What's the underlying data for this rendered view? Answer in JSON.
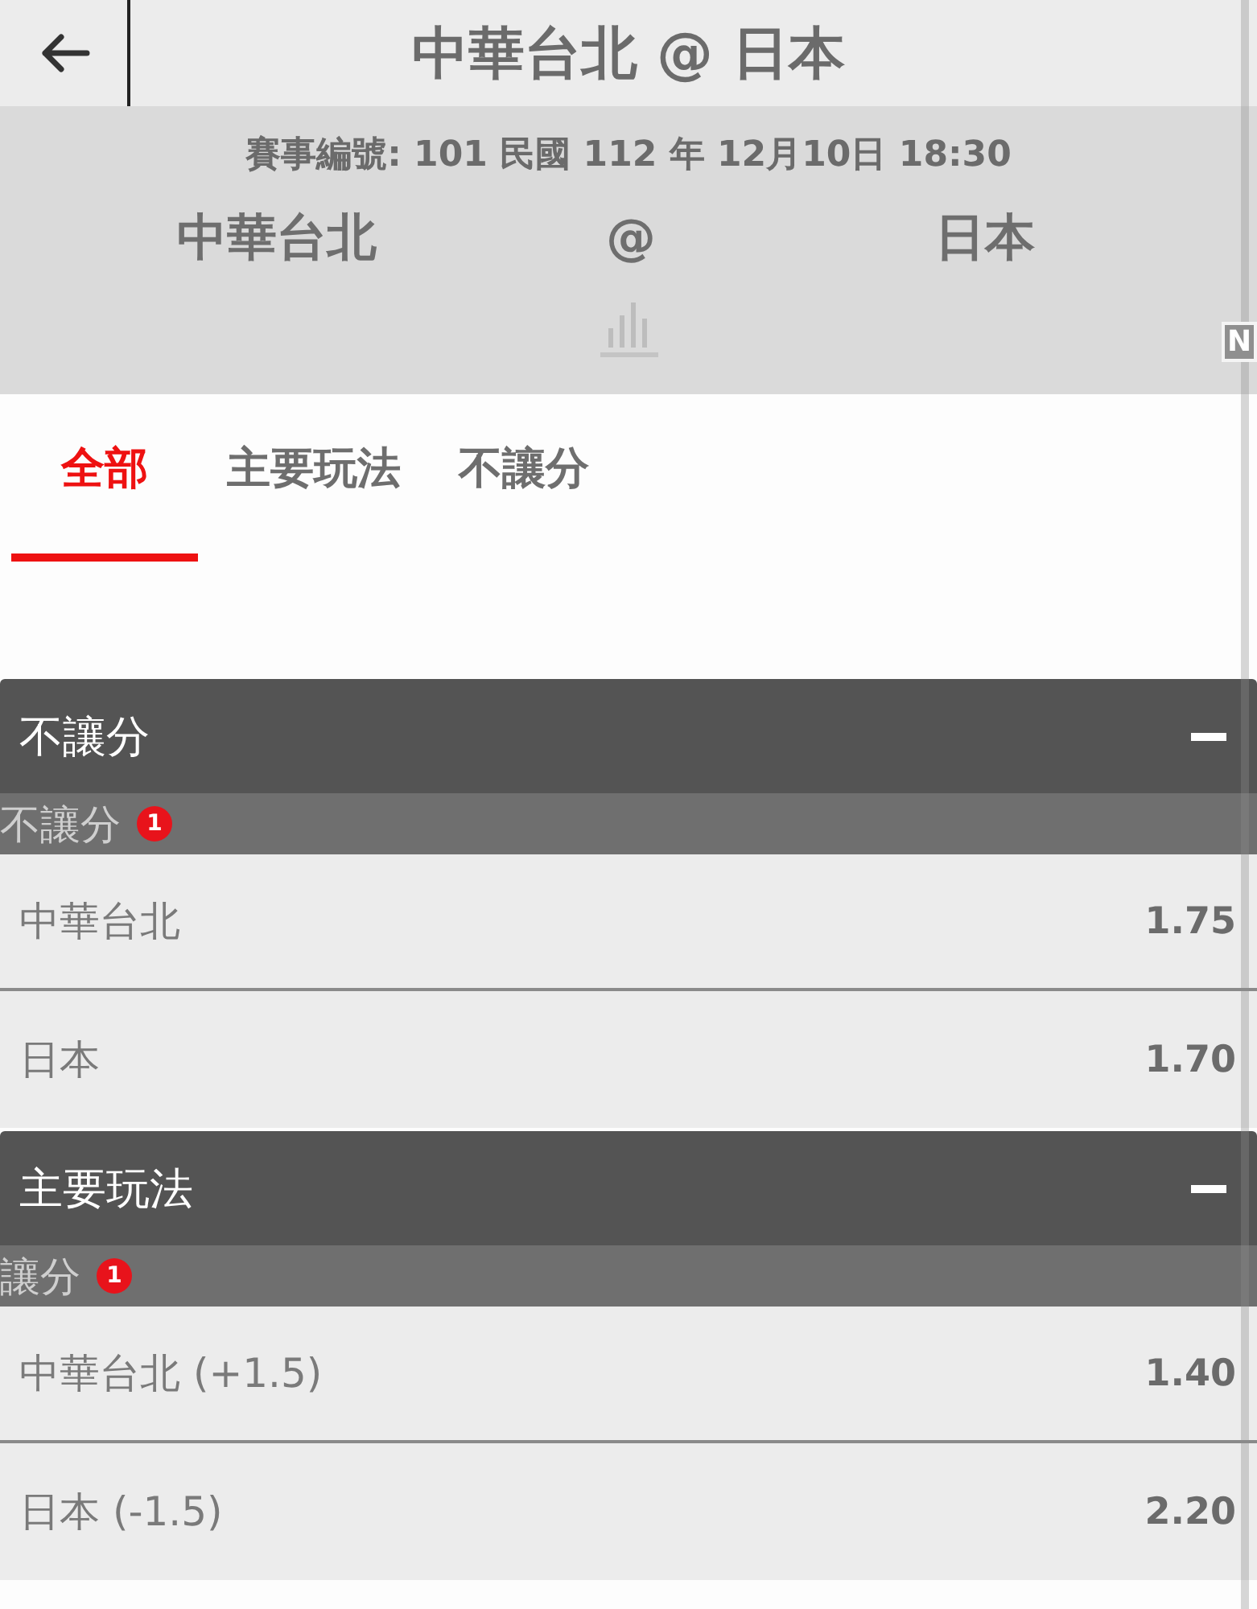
{
  "top_bar": {
    "title": "中華台北 @ 日本"
  },
  "match": {
    "info": "賽事編號: 101 民國 112 年 12月10日 18:30",
    "home": "中華台北",
    "separator": "@",
    "away": "日本",
    "badge": "N"
  },
  "tabs": [
    {
      "label": "全部",
      "selected": true
    },
    {
      "label": "主要玩法",
      "selected": false
    },
    {
      "label": "不讓分",
      "selected": false
    }
  ],
  "markets": [
    {
      "title": "不讓分",
      "expanded": true,
      "groups": [
        {
          "title": "不讓分",
          "count": "1",
          "selections": [
            {
              "name": "中華台北",
              "odds": "1.75"
            },
            {
              "name": "日本",
              "odds": "1.70"
            }
          ]
        }
      ]
    },
    {
      "title": "主要玩法",
      "expanded": true,
      "groups": [
        {
          "title": "讓分",
          "count": "1",
          "selections": [
            {
              "name": "中華台北 (+1.5)",
              "odds": "1.40"
            },
            {
              "name": "日本 (-1.5)",
              "odds": "2.20"
            }
          ]
        }
      ]
    }
  ]
}
